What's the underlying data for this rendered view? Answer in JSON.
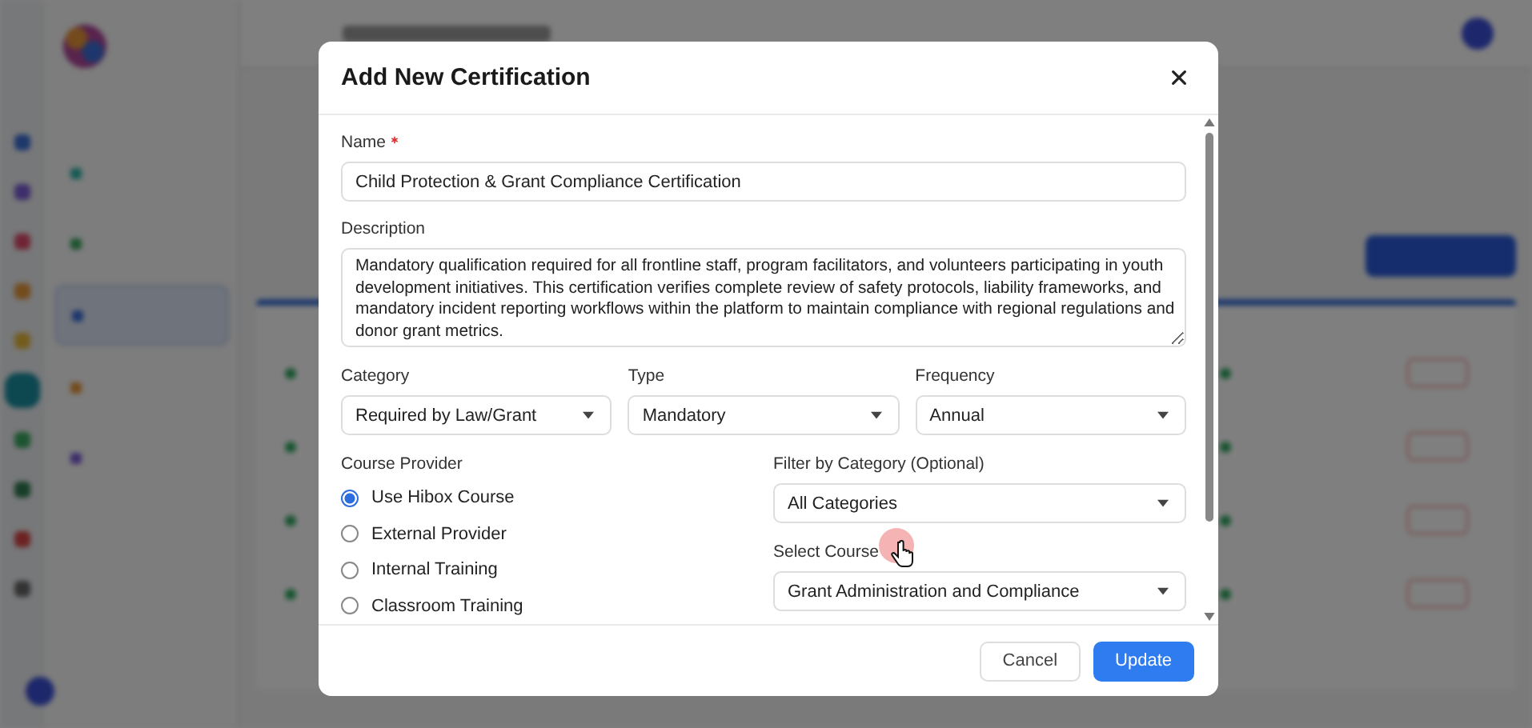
{
  "background": {
    "rail_items": [
      {
        "selected": false
      },
      {
        "selected": false
      },
      {
        "selected": false
      },
      {
        "selected": false
      },
      {
        "selected": false
      },
      {
        "selected": true
      },
      {
        "selected": false
      },
      {
        "selected": false
      },
      {
        "selected": false
      },
      {
        "selected": false
      }
    ],
    "menu_items": [
      {
        "selected": false
      },
      {
        "selected": false
      },
      {
        "selected": true
      },
      {
        "selected": false
      },
      {
        "selected": false
      }
    ]
  },
  "dialog": {
    "title": "Add New Certification",
    "name": {
      "label": "Name",
      "required": true,
      "value": "Child Protection & Grant Compliance Certification"
    },
    "description": {
      "label": "Description",
      "value": "Mandatory qualification required for all frontline staff, program facilitators, and volunteers participating in youth development initiatives. This certification verifies complete review of safety protocols, liability frameworks, and mandatory incident reporting workflows within the platform to maintain compliance with regional regulations and donor grant metrics."
    },
    "selects": [
      {
        "label": "Category",
        "value": "Required by Law/Grant"
      },
      {
        "label": "Type",
        "value": "Mandatory"
      },
      {
        "label": "Frequency",
        "value": "Annual"
      }
    ],
    "course_provider": {
      "label": "Course Provider",
      "options": [
        {
          "label": "Use Hibox Course",
          "selected": true
        },
        {
          "label": "External Provider",
          "selected": false
        },
        {
          "label": "Internal Training",
          "selected": false
        },
        {
          "label": "Classroom Training",
          "selected": false
        }
      ]
    },
    "filter": {
      "label": "Filter by Category (Optional)",
      "value": "All Categories"
    },
    "course": {
      "label": "Select Course",
      "value": "Grant Administration and Compliance"
    },
    "buttons": [
      {
        "label": "Cancel",
        "kind": "secondary"
      },
      {
        "label": "Update",
        "kind": "primary"
      }
    ]
  }
}
